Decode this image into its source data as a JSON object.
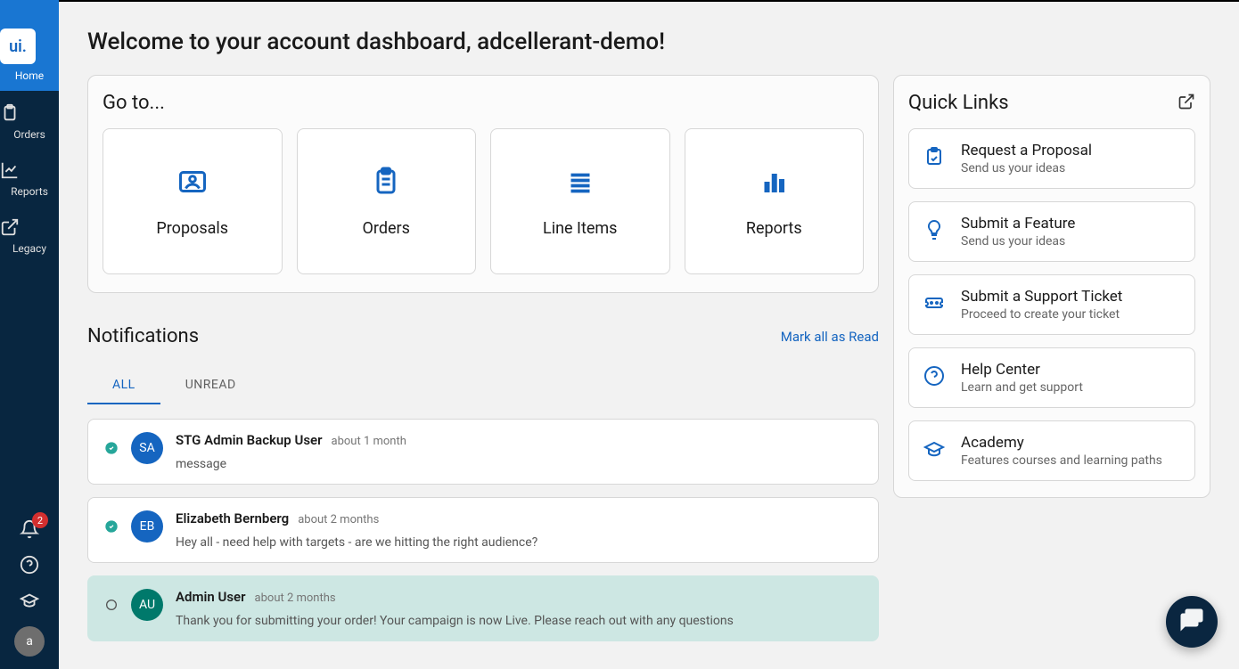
{
  "sidebar": {
    "logo": "ui.",
    "items": [
      {
        "label": "Home"
      },
      {
        "label": "Orders"
      },
      {
        "label": "Reports"
      },
      {
        "label": "Legacy"
      }
    ],
    "badge": "2",
    "avatar": "a"
  },
  "welcome": "Welcome to your account dashboard, adcellerant-demo!",
  "goto": {
    "title": "Go to...",
    "items": [
      {
        "label": "Proposals"
      },
      {
        "label": "Orders"
      },
      {
        "label": "Line Items"
      },
      {
        "label": "Reports"
      }
    ]
  },
  "notifications": {
    "title": "Notifications",
    "mark_all": "Mark all as Read",
    "tabs": {
      "all": "ALL",
      "unread": "UNREAD"
    },
    "items": [
      {
        "initials": "SA",
        "user": "STG Admin Backup User",
        "time": "about 1 month",
        "message": "message",
        "read": true,
        "avatar_color": "blue"
      },
      {
        "initials": "EB",
        "user": "Elizabeth Bernberg",
        "time": "about 2 months",
        "message": "Hey all - need help with targets - are we hitting the right audience?",
        "read": true,
        "avatar_color": "blue"
      },
      {
        "initials": "AU",
        "user": "Admin User",
        "time": "about 2 months",
        "message": "Thank you for submitting your order! Your campaign is now Live. Please reach out with any questions",
        "read": false,
        "avatar_color": "teal"
      }
    ]
  },
  "quicklinks": {
    "title": "Quick Links",
    "items": [
      {
        "label": "Request a Proposal",
        "sub": "Send us your ideas"
      },
      {
        "label": "Submit a Feature",
        "sub": "Send us your ideas"
      },
      {
        "label": "Submit a Support Ticket",
        "sub": "Proceed to create your ticket"
      },
      {
        "label": "Help Center",
        "sub": "Learn and get support"
      },
      {
        "label": "Academy",
        "sub": "Features courses and learning paths"
      }
    ]
  }
}
